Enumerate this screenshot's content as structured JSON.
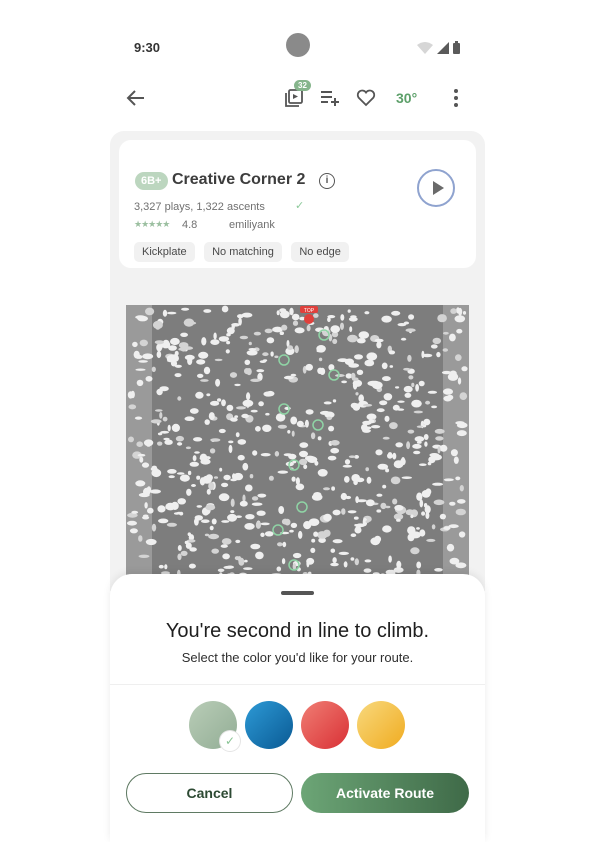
{
  "status_bar": {
    "time": "9:30"
  },
  "app_bar": {
    "queue_count": "32",
    "angle": "30°"
  },
  "route": {
    "grade": "6B+",
    "name": "Creative Corner 2",
    "stats": "3,327 plays, 1,322 ascents",
    "rating": "4.8",
    "stars": "★★★★★",
    "setter": "emiliyank",
    "tags": [
      "Kickplate",
      "No matching",
      "No edge"
    ]
  },
  "wall": {
    "top_marker": "TOP"
  },
  "sheet": {
    "heading": "You're second in line to climb.",
    "subheading": "Select the color you'd like for your route.",
    "colors": [
      {
        "name": "sage-green",
        "hex": "#a9c2a8",
        "selected": true
      },
      {
        "name": "blue",
        "hex": "#1b7ab8",
        "selected": false
      },
      {
        "name": "red",
        "hex": "#e65a56",
        "selected": false
      },
      {
        "name": "yellow",
        "hex": "#f4c24a",
        "selected": false
      }
    ],
    "cancel_label": "Cancel",
    "activate_label": "Activate Route"
  }
}
